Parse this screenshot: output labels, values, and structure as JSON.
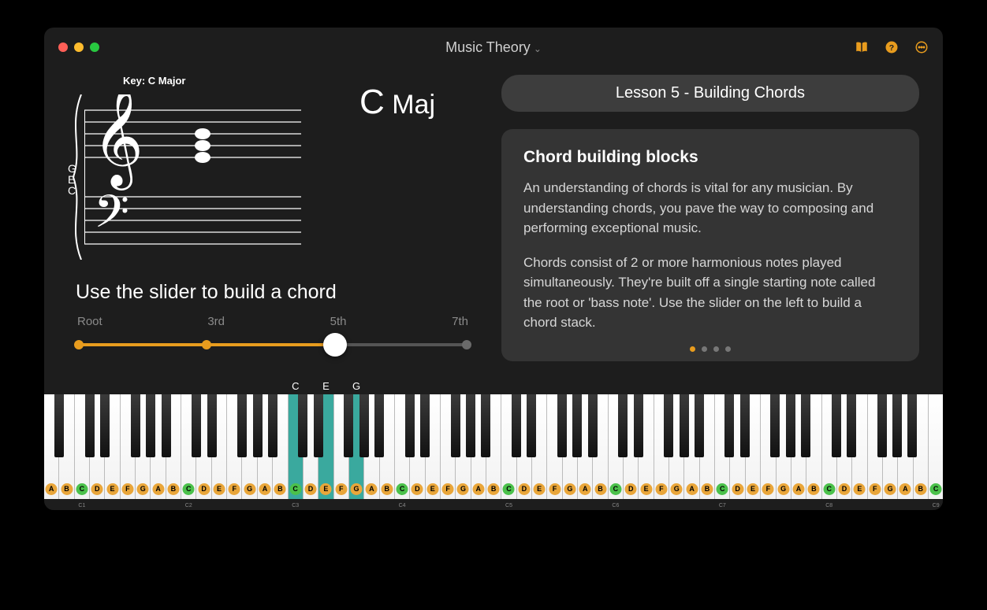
{
  "header": {
    "title": "Music Theory"
  },
  "staff": {
    "key_label": "Key: C Major",
    "chord_root": "C",
    "chord_quality": " Maj",
    "side_notes": [
      "G",
      "E",
      "C"
    ]
  },
  "slider": {
    "title": "Use the slider to build a chord",
    "labels": [
      "Root",
      "3rd",
      "5th",
      "7th"
    ],
    "positions_pct": [
      0,
      33,
      66,
      100
    ],
    "value_index": 2
  },
  "chord_key_labels": [
    "C",
    "E",
    "G"
  ],
  "lesson": {
    "pill": "Lesson 5 - Building Chords",
    "heading": "Chord building blocks",
    "para1": "An understanding of chords is vital for any musician. By understanding chords, you pave the way to composing and performing exceptional music.",
    "para2": "Chords consist of 2 or more harmonious notes played simultaneously. They're built off a single starting note called the root or 'bass note'.  Use the slider on the left to build a chord stack.",
    "page_count": 4,
    "page_active": 0
  },
  "piano": {
    "start_note": "A",
    "white_count": 59,
    "highlight_white_indices": [
      16,
      18,
      20
    ],
    "note_letters": [
      "A",
      "B",
      "C",
      "D",
      "E",
      "F",
      "G"
    ],
    "c_is_green": true,
    "c_octave_start": 1,
    "chord_label_white_indices": {
      "C": 16,
      "E": 18,
      "G": 20
    }
  }
}
